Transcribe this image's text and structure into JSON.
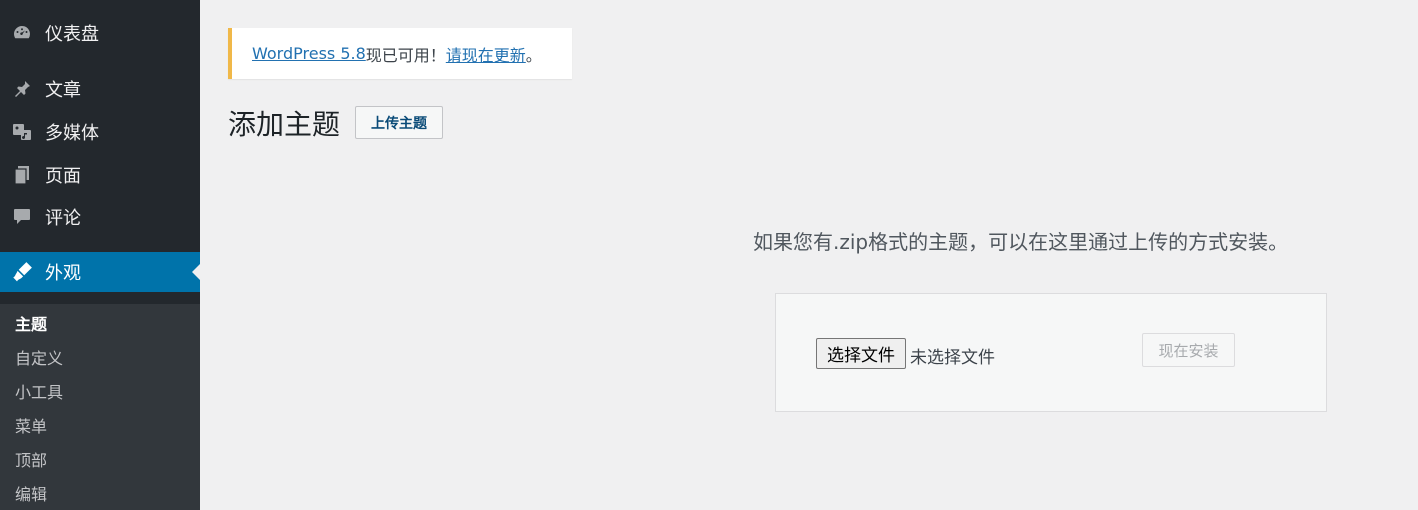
{
  "sidebar": {
    "items": [
      {
        "label": "仪表盘",
        "icon": "dashboard-icon"
      },
      {
        "label": "文章",
        "icon": "pin-icon"
      },
      {
        "label": "多媒体",
        "icon": "media-icon"
      },
      {
        "label": "页面",
        "icon": "pages-icon"
      },
      {
        "label": "评论",
        "icon": "comment-icon"
      },
      {
        "label": "外观",
        "icon": "appearance-icon",
        "active": true
      }
    ],
    "submenu": [
      "主题",
      "自定义",
      "小工具",
      "菜单",
      "顶部",
      "编辑"
    ],
    "submenu_current": "主题"
  },
  "notice": {
    "version_link": "WordPress 5.8",
    "text": "现已可用！",
    "update_link": "请现在更新",
    "suffix": "。"
  },
  "header": {
    "title": "添加主题",
    "upload_button": "上传主题"
  },
  "upload": {
    "description": "如果您有.zip格式的主题，可以在这里通过上传的方式安装。",
    "choose_file": "选择文件",
    "no_file": "未选择文件",
    "install_button": "现在安装"
  },
  "colors": {
    "sidebar_bg": "#23282d",
    "submenu_bg": "#32373c",
    "active_bg": "#0073aa",
    "notice_border": "#f0b849",
    "link": "#2271b1"
  }
}
